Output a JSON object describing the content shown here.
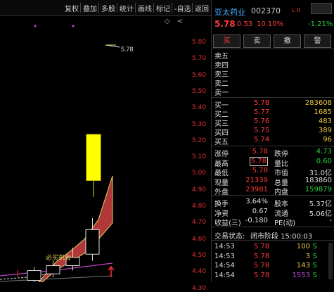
{
  "toolbar": {
    "items": [
      "复权",
      "叠加",
      "多股",
      "统计",
      "画线",
      "标记",
      "-自选",
      "返回"
    ]
  },
  "chart": {
    "y_labels": [
      "5.80",
      "5.70",
      "5.60",
      "5.50",
      "5.40",
      "5.30",
      "5.20",
      "5.10",
      "5.00",
      "4.90",
      "4.80",
      "4.70",
      "4.60",
      "4.50",
      "4.40",
      "4.30"
    ],
    "price_annotation": "5.78",
    "indicator_label": "必买机会",
    "candles": [
      {
        "o": 4.34,
        "c": 4.34,
        "h": 4.34,
        "l": 4.3
      },
      {
        "o": 4.36,
        "c": 4.42,
        "h": 4.44,
        "l": 4.32
      },
      {
        "o": 4.4,
        "c": 4.45,
        "h": 4.48,
        "l": 4.38
      },
      {
        "o": 4.45,
        "c": 4.5,
        "h": 4.56,
        "l": 4.42
      },
      {
        "o": 4.52,
        "c": 4.67,
        "h": 4.74,
        "l": 4.48
      },
      {
        "o": 4.97,
        "c": 5.25,
        "h": 5.25,
        "l": 4.87
      }
    ]
  },
  "stock": {
    "name": "亚太药业",
    "code": "002370",
    "flags": "L R",
    "price": "5.78",
    "change": "0.53",
    "change_pct": "10.10%",
    "side_pct": "-1.21%"
  },
  "buttons": [
    "买",
    "卖",
    "撤",
    "警"
  ],
  "sell_orders": [
    "卖五",
    "卖四",
    "卖三",
    "卖二",
    "卖一"
  ],
  "buy_orders": [
    {
      "label": "买一",
      "price": "5.78",
      "vol": "283608"
    },
    {
      "label": "买二",
      "price": "5.77",
      "vol": "1685"
    },
    {
      "label": "买三",
      "price": "5.76",
      "vol": "483"
    },
    {
      "label": "买四",
      "price": "5.75",
      "vol": "389"
    },
    {
      "label": "买五",
      "price": "5.74",
      "vol": "96"
    }
  ],
  "stats": [
    {
      "l1": "涨停",
      "v1": "5.78",
      "c1": "red",
      "l2": "跌停",
      "v2": "4.73",
      "c2": "green"
    },
    {
      "l1": "最高",
      "v1": "5.78",
      "c1": "red",
      "l2": "量比",
      "v2": "0.60",
      "c2": "green"
    },
    {
      "l1": "最低",
      "v1": "5.78",
      "c1": "red",
      "l2": "市值",
      "v2": "31.0亿",
      "c2": "white"
    },
    {
      "l1": "现量",
      "v1": "21339",
      "c1": "red",
      "l2": "总量",
      "v2": "183860",
      "c2": "white"
    },
    {
      "l1": "外盘",
      "v1": "23981",
      "c1": "red",
      "l2": "内盘",
      "v2": "159879",
      "c2": "green"
    }
  ],
  "stats2": [
    {
      "l1": "换手",
      "v1": "3.64%",
      "l2": "股本",
      "v2": "5.37亿"
    },
    {
      "l1": "净资",
      "v1": "0.67",
      "l2": "流通",
      "v2": "5.06亿"
    },
    {
      "l1": "收益(三)",
      "v1": "-0.180",
      "l2": "PE(动)",
      "v2": "-"
    }
  ],
  "trade_status_label": "交易状态:",
  "trade_status": "闭市阶段 15:00:03",
  "ticks": [
    {
      "time": "14:53",
      "price": "5.78",
      "vol": "100",
      "flag": "S",
      "vc": "yellow"
    },
    {
      "time": "14:53",
      "price": "5.78",
      "vol": "3",
      "flag": "S",
      "vc": "yellow"
    },
    {
      "time": "14:54",
      "price": "5.78",
      "vol": "143",
      "flag": "S",
      "vc": "yellow"
    },
    {
      "time": "14:54",
      "price": "5.78",
      "vol": "1553",
      "flag": "S",
      "vc": "purple"
    }
  ]
}
